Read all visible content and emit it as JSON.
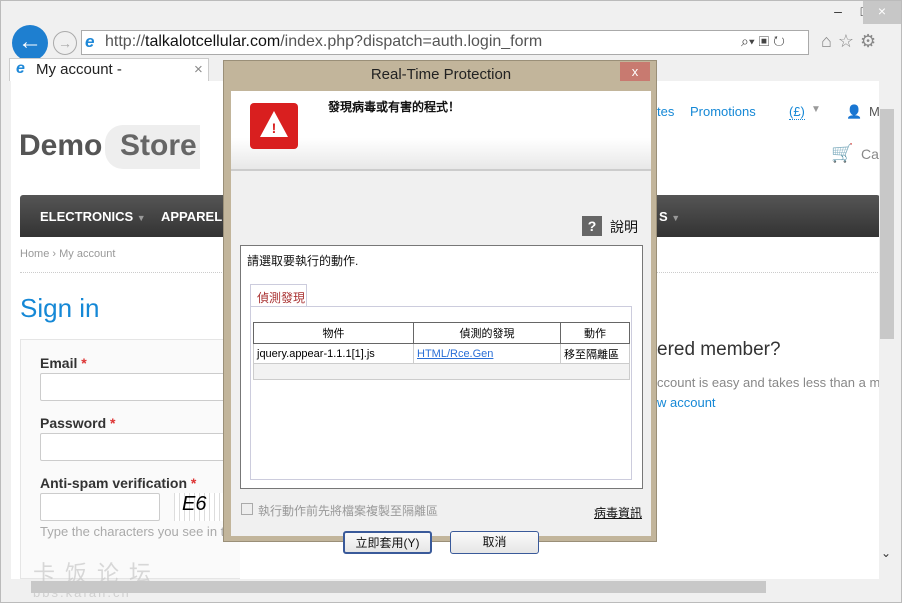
{
  "browser": {
    "url_prefix": "http://",
    "url_domain": "talkalotcellular.com",
    "url_path": "/index.php?dispatch=auth.login_form",
    "tab_title": "My account -",
    "tab_close": "×",
    "window_controls": {
      "minimize": "–",
      "maximize": "□",
      "close": "×"
    }
  },
  "store": {
    "logo_demo": "Demo",
    "logo_store": "Store",
    "top_links": [
      "tes",
      "Promotions",
      "(£)",
      "M"
    ],
    "cart": "Ca",
    "nav": [
      "ELECTRONICS",
      "APPAREL",
      "S"
    ],
    "breadcrumb": {
      "home": "Home",
      "sep": "›",
      "current": "My account"
    },
    "title": "Sign in",
    "email_label": "Email",
    "password_label": "Password",
    "antispam_label": "Anti-spam verification",
    "required": "*",
    "captcha_text": "E6",
    "hint": "Type the characters you see in t",
    "member_title": "ered member?",
    "member_text": "ccount is easy and takes less than a m",
    "new_account": "w account"
  },
  "dialog": {
    "title": "Real-Time Protection",
    "close": "x",
    "message": "發現病毒或有害的程式！",
    "help": "說明",
    "help_icon": "?",
    "choose": "請選取要執行的動作.",
    "tab": "偵測發現",
    "columns": [
      "物件",
      "偵測的發現",
      "動作"
    ],
    "rows": [
      {
        "object": "jquery.appear-1.1.1[1].js",
        "detection": "HTML/Rce.Gen",
        "action": "移至隔離區"
      }
    ],
    "checkbox_label": "執行動作前先將檔案複製至隔離區",
    "checkbox_checked": false,
    "virus_info": "病毒資訊",
    "apply": "立即套用(Y)",
    "cancel": "取消"
  },
  "watermark": {
    "line1": "卡饭论坛",
    "line2": "bbs.kafan.cn"
  }
}
